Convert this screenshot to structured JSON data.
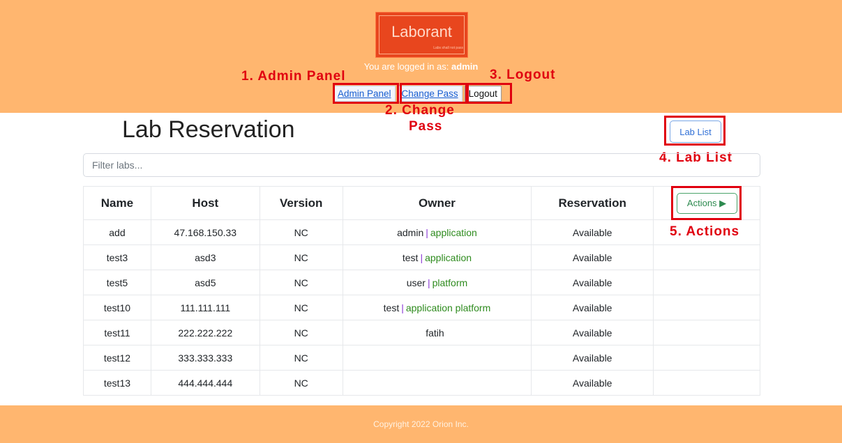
{
  "header": {
    "logo": {
      "title": "Laborant",
      "subtitle": "Labs shall not pass"
    },
    "logged_in_prefix": "You are logged in as:",
    "username": "admin",
    "nav": {
      "admin_panel": "Admin Panel",
      "change_pass": "Change Pass",
      "logout": "Logout"
    }
  },
  "annotations": {
    "admin_panel": "1. Admin Panel",
    "change_pass_line1": "2. Change",
    "change_pass_line2": "Pass",
    "logout": "3. Logout",
    "lab_list": "4. Lab List",
    "actions": "5. Actions"
  },
  "main": {
    "title": "Lab Reservation",
    "lab_list_button": "Lab List",
    "filter_placeholder": "Filter labs...",
    "columns": [
      "Name",
      "Host",
      "Version",
      "Owner",
      "Reservation"
    ],
    "actions_button": "Actions ▶",
    "rows": [
      {
        "name": "add",
        "host": "47.168.150.33",
        "version": "NC",
        "owner": "admin",
        "sep": "|",
        "tags": "application",
        "reservation": "Available"
      },
      {
        "name": "test3",
        "host": "asd3",
        "version": "NC",
        "owner": "test",
        "sep": "|",
        "tags": "application",
        "reservation": "Available"
      },
      {
        "name": "test5",
        "host": "asd5",
        "version": "NC",
        "owner": "user",
        "sep": "|",
        "tags": "platform",
        "reservation": "Available"
      },
      {
        "name": "test10",
        "host": "111.111.111",
        "version": "NC",
        "owner": "test",
        "sep": "|",
        "tags": "application platform",
        "reservation": "Available"
      },
      {
        "name": "test11",
        "host": "222.222.222",
        "version": "NC",
        "owner": "fatih",
        "sep": "",
        "tags": "",
        "reservation": "Available"
      },
      {
        "name": "test12",
        "host": "333.333.333",
        "version": "NC",
        "owner": "",
        "sep": "",
        "tags": "",
        "reservation": "Available"
      },
      {
        "name": "test13",
        "host": "444.444.444",
        "version": "NC",
        "owner": "",
        "sep": "",
        "tags": "",
        "reservation": "Available"
      }
    ]
  },
  "footer": {
    "copyright": "Copyright 2022 Orion Inc."
  },
  "colors": {
    "header_bg": "#ffb66f",
    "annotation_red": "#e0000f",
    "available": "#c2a65a",
    "owner_tag": "#2e8b1e"
  }
}
